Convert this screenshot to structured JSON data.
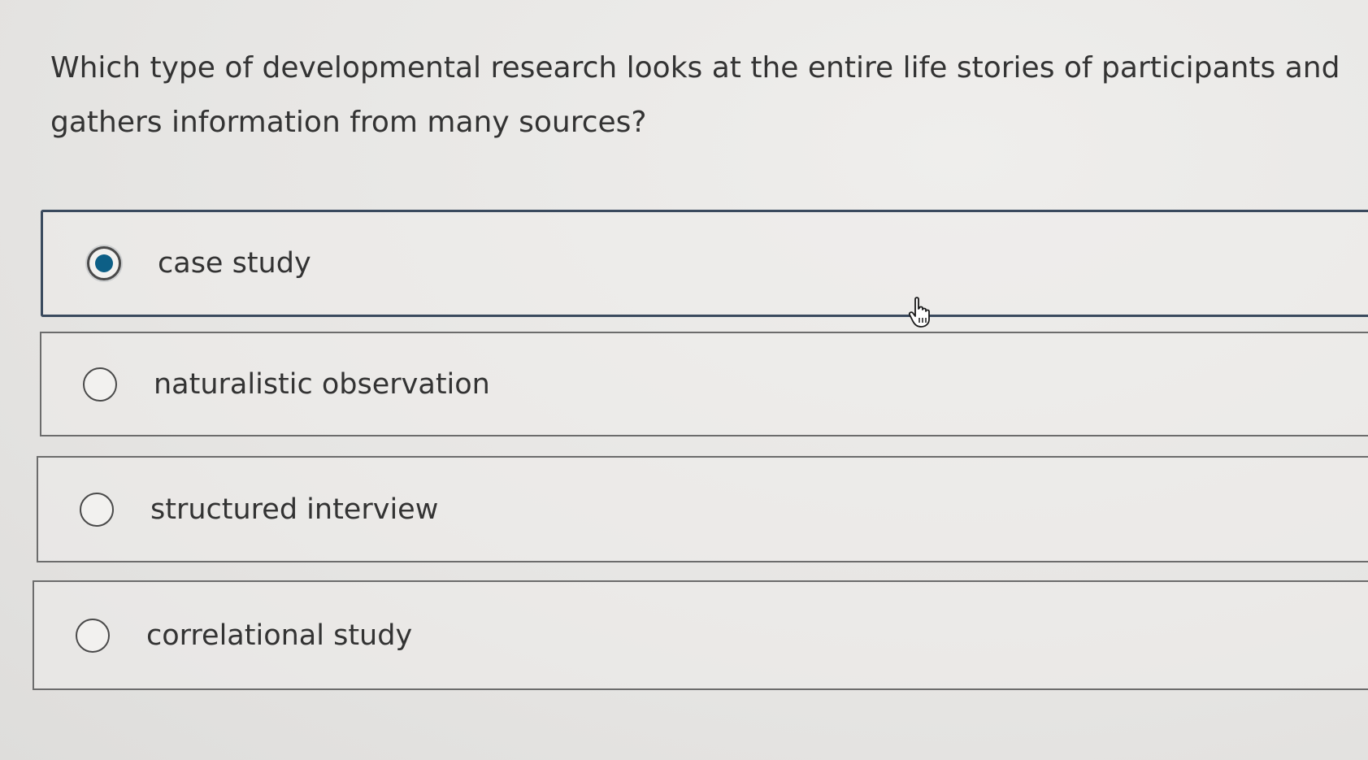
{
  "question": {
    "text": "Which type of developmental research looks at the entire life stories of participants and gathers information from many sources?"
  },
  "options": [
    {
      "label": "case study",
      "selected": true,
      "icon": "radio-selected-icon"
    },
    {
      "label": "naturalistic observation",
      "selected": false,
      "icon": "radio-icon"
    },
    {
      "label": "structured interview",
      "selected": false,
      "icon": "radio-icon"
    },
    {
      "label": "correlational study",
      "selected": false,
      "icon": "radio-icon"
    }
  ],
  "colors": {
    "accent": "#0d5f86",
    "selected_border": "#3a4a5e",
    "border": "#6c6c6c",
    "background": "#e9e8e6",
    "text": "#333333"
  },
  "cursor": {
    "icon": "hand-pointer-icon"
  }
}
